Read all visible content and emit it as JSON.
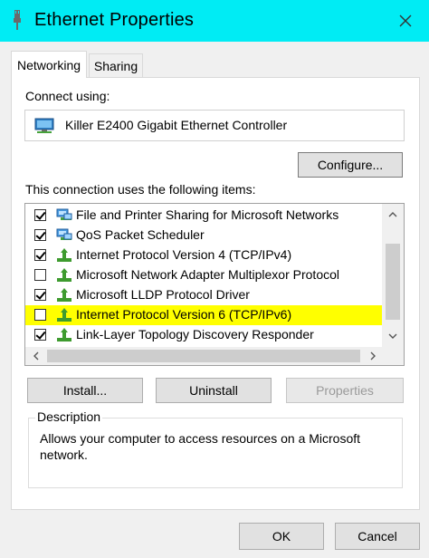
{
  "window": {
    "title": "Ethernet Properties",
    "title_bar_color": "#00ecf4"
  },
  "tabs": [
    {
      "label": "Networking",
      "active": true
    },
    {
      "label": "Sharing",
      "active": false
    }
  ],
  "connect_using": {
    "label": "Connect using:",
    "adapter": "Killer E2400 Gigabit Ethernet Controller",
    "configure_label": "Configure..."
  },
  "items_section": {
    "label": "This connection uses the following items:",
    "items": [
      {
        "label": "File and Printer Sharing for Microsoft Networks",
        "checked": true,
        "icon": "client-service-icon",
        "highlighted": false
      },
      {
        "label": "QoS Packet Scheduler",
        "checked": true,
        "icon": "client-service-icon",
        "highlighted": false
      },
      {
        "label": "Internet Protocol Version 4 (TCP/IPv4)",
        "checked": true,
        "icon": "protocol-icon",
        "highlighted": false
      },
      {
        "label": "Microsoft Network Adapter Multiplexor Protocol",
        "checked": false,
        "icon": "protocol-icon",
        "highlighted": false
      },
      {
        "label": "Microsoft LLDP Protocol Driver",
        "checked": true,
        "icon": "protocol-icon",
        "highlighted": false
      },
      {
        "label": "Internet Protocol Version 6 (TCP/IPv6)",
        "checked": false,
        "icon": "protocol-icon",
        "highlighted": true
      },
      {
        "label": "Link-Layer Topology Discovery Responder",
        "checked": true,
        "icon": "protocol-icon",
        "highlighted": false
      }
    ],
    "highlight_color": "#ffff00"
  },
  "buttons": {
    "install": "Install...",
    "uninstall": "Uninstall",
    "properties": "Properties",
    "ok": "OK",
    "cancel": "Cancel"
  },
  "description": {
    "label": "Description",
    "text": "Allows your computer to access resources on a Microsoft network."
  }
}
